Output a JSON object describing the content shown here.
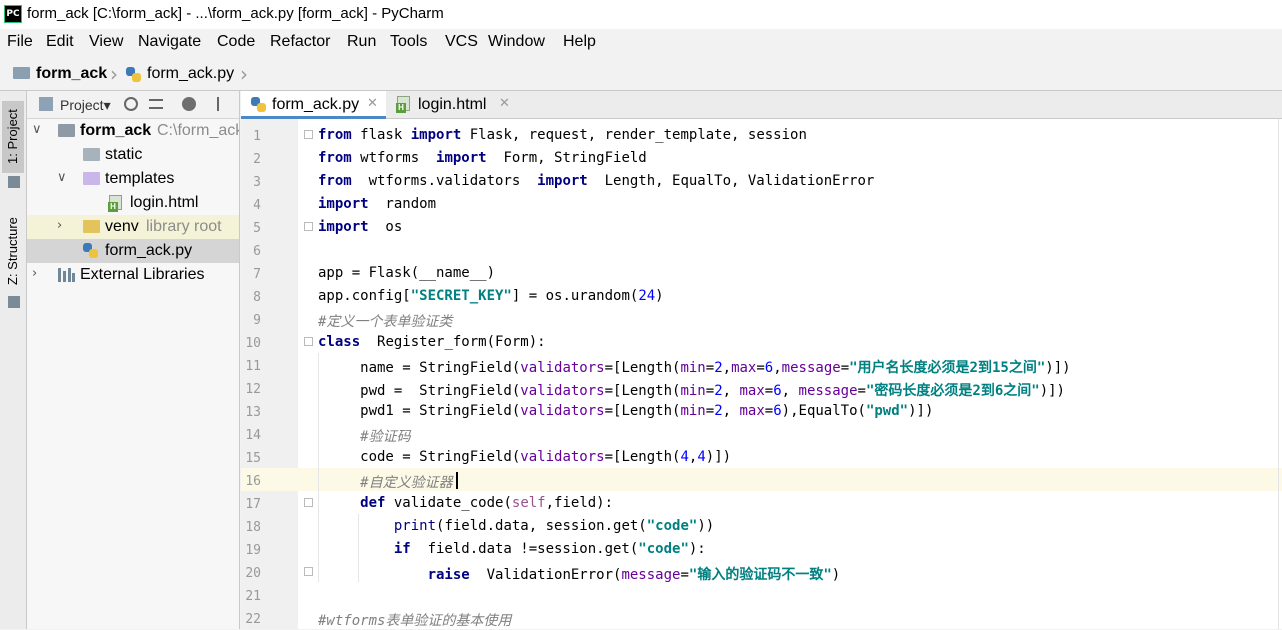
{
  "window": {
    "title": "form_ack [C:\\form_ack] - ...\\form_ack.py [form_ack] - PyCharm",
    "app_icon_text": "PC"
  },
  "menu": [
    "File",
    "Edit",
    "View",
    "Navigate",
    "Code",
    "Refactor",
    "Run",
    "Tools",
    "VCS",
    "Window",
    "Help"
  ],
  "breadcrumb": {
    "project": "form_ack",
    "file": "form_ack.py"
  },
  "tool_strip": {
    "project_tab": "1: Project",
    "structure_tab": "Z: Structure"
  },
  "project_panel": {
    "title": "Project▾",
    "tree": [
      {
        "label": "form_ack",
        "sub": "C:\\form_ack"
      },
      {
        "label": "static"
      },
      {
        "label": "templates"
      },
      {
        "label": "login.html"
      },
      {
        "label": "venv",
        "sub": "library root"
      },
      {
        "label": "form_ack.py"
      },
      {
        "label": "External Libraries"
      }
    ]
  },
  "tabs": [
    {
      "label": "form_ack.py",
      "active": true
    },
    {
      "label": "login.html",
      "active": false
    }
  ],
  "editor": {
    "line_numbers": [
      "1",
      "2",
      "3",
      "4",
      "5",
      "6",
      "7",
      "8",
      "9",
      "10",
      "11",
      "12",
      "13",
      "14",
      "15",
      "16",
      "17",
      "18",
      "19",
      "20",
      "21",
      "22"
    ],
    "caret_line": 16,
    "lines": [
      [
        [
          "kw",
          "from"
        ],
        [
          "t",
          " flask "
        ],
        [
          "kw",
          "import"
        ],
        [
          "t",
          " Flask, request, render_template, session"
        ]
      ],
      [
        [
          "kw",
          "from"
        ],
        [
          "t",
          " wtforms  "
        ],
        [
          "kw",
          "import"
        ],
        [
          "t",
          "  Form, StringField"
        ]
      ],
      [
        [
          "kw",
          "from"
        ],
        [
          "t",
          "  wtforms.validators  "
        ],
        [
          "kw",
          "import"
        ],
        [
          "t",
          "  Length, EqualTo, ValidationError"
        ]
      ],
      [
        [
          "kw",
          "import"
        ],
        [
          "t",
          "  random"
        ]
      ],
      [
        [
          "kw",
          "import"
        ],
        [
          "t",
          "  os"
        ]
      ],
      [],
      [
        [
          "t",
          "app = Flask(__name__)"
        ]
      ],
      [
        [
          "t",
          "app.config["
        ],
        [
          "str",
          "\"SECRET_KEY\""
        ],
        [
          "t",
          "] = os.urandom("
        ],
        [
          "num",
          "24"
        ],
        [
          "t",
          ")"
        ]
      ],
      [
        [
          "cmt",
          "#定义一个表单验证类"
        ]
      ],
      [
        [
          "kw",
          "class"
        ],
        [
          "t",
          "  Register_form(Form):"
        ]
      ],
      [
        [
          "t",
          "     name = StringField("
        ],
        [
          "param",
          "validators"
        ],
        [
          "t",
          "=[Length("
        ],
        [
          "param",
          "min"
        ],
        [
          "t",
          "="
        ],
        [
          "num",
          "2"
        ],
        [
          "t",
          ","
        ],
        [
          "param",
          "max"
        ],
        [
          "t",
          "="
        ],
        [
          "num",
          "6"
        ],
        [
          "t",
          ","
        ],
        [
          "param",
          "message"
        ],
        [
          "t",
          "="
        ],
        [
          "str",
          "\"用户名长度必须是2到15之间\""
        ],
        [
          "t",
          ")])"
        ]
      ],
      [
        [
          "t",
          "     pwd =  StringField("
        ],
        [
          "param",
          "validators"
        ],
        [
          "t",
          "=[Length("
        ],
        [
          "param",
          "min"
        ],
        [
          "t",
          "="
        ],
        [
          "num",
          "2"
        ],
        [
          "t",
          ", "
        ],
        [
          "param",
          "max"
        ],
        [
          "t",
          "="
        ],
        [
          "num",
          "6"
        ],
        [
          "t",
          ", "
        ],
        [
          "param",
          "message"
        ],
        [
          "t",
          "="
        ],
        [
          "str",
          "\"密码长度必须是2到6之间\""
        ],
        [
          "t",
          ")])"
        ]
      ],
      [
        [
          "t",
          "     pwd1 = StringField("
        ],
        [
          "param",
          "validators"
        ],
        [
          "t",
          "=[Length("
        ],
        [
          "param",
          "min"
        ],
        [
          "t",
          "="
        ],
        [
          "num",
          "2"
        ],
        [
          "t",
          ", "
        ],
        [
          "param",
          "max"
        ],
        [
          "t",
          "="
        ],
        [
          "num",
          "6"
        ],
        [
          "t",
          "),EqualTo("
        ],
        [
          "str",
          "\"pwd\""
        ],
        [
          "t",
          ")])"
        ]
      ],
      [
        [
          "t",
          "     "
        ],
        [
          "cmt",
          "#验证码"
        ]
      ],
      [
        [
          "t",
          "     code = StringField("
        ],
        [
          "param",
          "validators"
        ],
        [
          "t",
          "=[Length("
        ],
        [
          "num",
          "4"
        ],
        [
          "t",
          ","
        ],
        [
          "num",
          "4"
        ],
        [
          "t",
          ")])"
        ]
      ],
      [
        [
          "t",
          "     "
        ],
        [
          "cmt",
          "#自定义验证器"
        ]
      ],
      [
        [
          "t",
          "     "
        ],
        [
          "kw",
          "def"
        ],
        [
          "t",
          " validate_code("
        ],
        [
          "selfkw",
          "self"
        ],
        [
          "t",
          ",field):"
        ]
      ],
      [
        [
          "t",
          "         "
        ],
        [
          "builtin",
          "print"
        ],
        [
          "t",
          "(field.data, session.get("
        ],
        [
          "str",
          "\"code\""
        ],
        [
          "t",
          "))"
        ]
      ],
      [
        [
          "t",
          "         "
        ],
        [
          "kw",
          "if"
        ],
        [
          "t",
          "  field.data !=session.get("
        ],
        [
          "str",
          "\"code\""
        ],
        [
          "t",
          "):"
        ]
      ],
      [
        [
          "t",
          "             "
        ],
        [
          "kw",
          "raise"
        ],
        [
          "t",
          "  ValidationError("
        ],
        [
          "param",
          "message"
        ],
        [
          "t",
          "="
        ],
        [
          "str",
          "\"输入的验证码不一致\""
        ],
        [
          "t",
          ")"
        ]
      ],
      [],
      [
        [
          "cmt",
          "#wtforms表单验证的基本使用"
        ]
      ]
    ]
  }
}
